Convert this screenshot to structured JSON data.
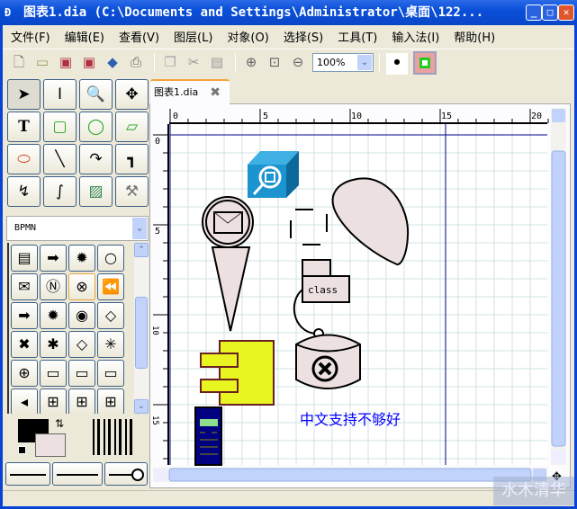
{
  "window": {
    "title": "图表1.dia (C:\\Documents and Settings\\Administrator\\桌面\\122...",
    "minimize": "_",
    "maximize": "□",
    "close": "✕"
  },
  "menu": [
    "文件(F)",
    "编辑(E)",
    "查看(V)",
    "图层(L)",
    "对象(O)",
    "选择(S)",
    "工具(T)",
    "输入法(I)",
    "帮助(H)"
  ],
  "toolbar": {
    "zoom_value": "100%",
    "buttons": [
      "new",
      "open",
      "save",
      "save-as",
      "export",
      "print",
      "copy",
      "cut",
      "paste",
      "zoom-in",
      "zoom-fit",
      "zoom-out",
      "snap-grid",
      "toggle-view"
    ]
  },
  "tools": [
    "pointer",
    "text-cursor",
    "magnify",
    "scroll",
    "text",
    "box",
    "ellipse",
    "polygon",
    "beziergon",
    "line",
    "arc",
    "zigzag-line",
    "polyline",
    "bezier-line",
    "image",
    "outline"
  ],
  "sheet": {
    "selected": "BPMN",
    "shapes": [
      "data-object",
      "message-event",
      "compensation",
      "end-event",
      "message-start",
      "link",
      "cancel",
      "rewind",
      "intermediate-message",
      "multiple",
      "terminate",
      "gateway",
      "exclusive-gateway",
      "complex-gateway",
      "inclusive-gateway",
      "parallel-gateway-star",
      "parallel-gateway",
      "task",
      "loop-task",
      "sub-process",
      "compensation-task",
      "collapsed-subprocess",
      "loop-subprocess",
      "adhoc-subprocess"
    ],
    "selected_shape": "cancel"
  },
  "colors": {
    "foreground": "#000000",
    "background": "#ede0e0",
    "accent": "#0a46c8",
    "tab_accent": "#f4a33a"
  },
  "tab": {
    "label": "图表1.dia"
  },
  "ruler": {
    "top_ticks": [
      "0",
      "5",
      "10",
      "15",
      "20"
    ],
    "left_ticks": [
      "0",
      "5",
      "10",
      "15"
    ]
  },
  "canvas": {
    "class_label": "class",
    "chinese_text": "中文支持不够好",
    "text_color": "#0000ff"
  },
  "watermark": "水木清华"
}
